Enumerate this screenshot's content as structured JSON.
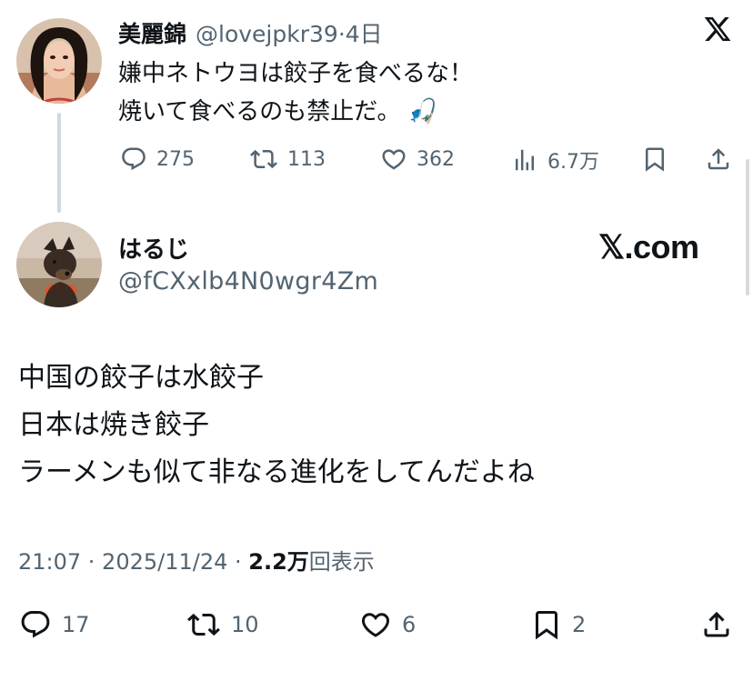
{
  "parent_tweet": {
    "display_name": "美麗錦",
    "handle": "@lovejpkr39",
    "separator": "·",
    "time": "4日",
    "lines": [
      "嫌中ネトウヨは餃子を食べるな！",
      "焼いて食べるのも禁止だ。"
    ],
    "emoji": "🎣",
    "stats": {
      "replies": "275",
      "reposts": "113",
      "likes": "362",
      "views": "6.7万"
    }
  },
  "reply_tweet": {
    "display_name": "はるじ",
    "handle": "@fCXxlb4N0wgr4Zm",
    "watermark": "𝕏.com",
    "lines": [
      "中国の餃子は水餃子",
      "日本は焼き餃子",
      "ラーメンも似て非なる進化をしてんだよね"
    ],
    "timestamp": "21:07 · 2025/11/24 · ",
    "views_count": "2.2万",
    "views_label": "回表示",
    "stats": {
      "replies": "17",
      "reposts": "10",
      "likes": "6",
      "bookmarks": "2"
    }
  },
  "icons": {
    "reply": "reply-icon",
    "repost": "repost-icon",
    "like": "like-icon",
    "views": "views-icon",
    "bookmark": "bookmark-icon",
    "share": "share-icon",
    "x_logo": "x-logo-icon"
  },
  "colors": {
    "text": "#0f1419",
    "muted": "#536471",
    "thread_line": "#cfd9de"
  }
}
